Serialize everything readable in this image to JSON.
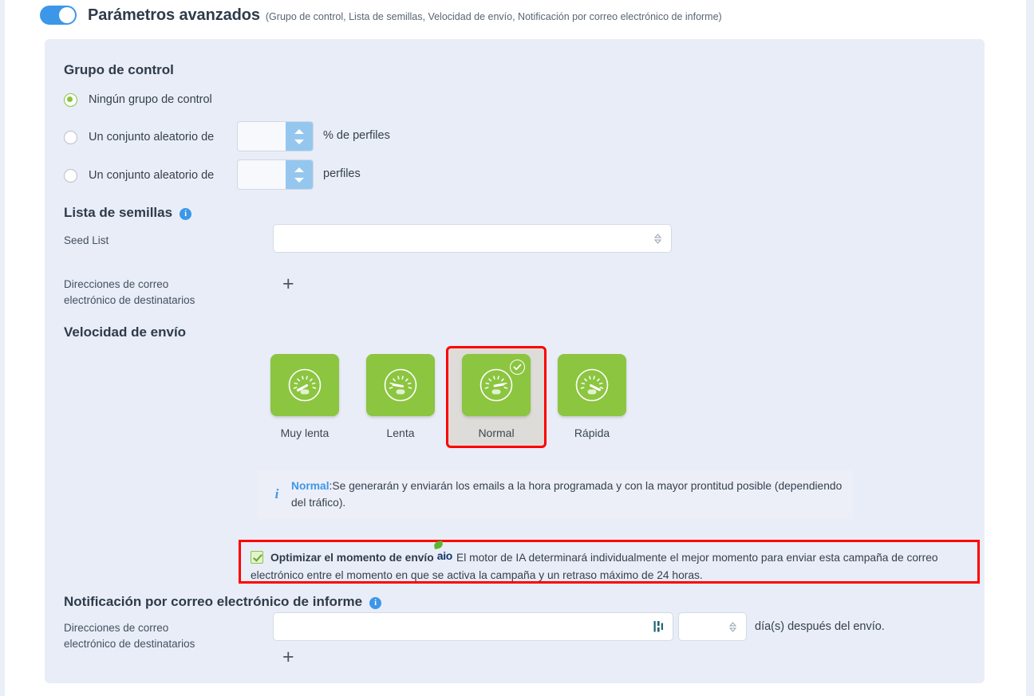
{
  "header": {
    "toggle_state": "on",
    "title": "Parámetros avanzados",
    "subtitle": "(Grupo de control, Lista de semillas, Velocidad de envío, Notificación por correo electrónico de informe)"
  },
  "control_group": {
    "title": "Grupo de control",
    "options": [
      {
        "label": "Ningún grupo de control",
        "selected": true
      },
      {
        "label": "Un conjunto aleatorio de",
        "selected": false,
        "value": "",
        "unit": "% de perfiles"
      },
      {
        "label": "Un conjunto aleatorio de",
        "selected": false,
        "value": "",
        "unit": "perfiles"
      }
    ]
  },
  "seed_list": {
    "title": "Lista de semillas",
    "info_icon": "info-icon",
    "seed_label": "Seed List",
    "seed_value": "",
    "recipients_label": "Direcciones de correo electrónico de destinatarios",
    "add_label": "+"
  },
  "speed": {
    "title": "Velocidad de envío",
    "tiles": [
      {
        "label": "Muy lenta",
        "icon": "gauge-icon",
        "selected": false
      },
      {
        "label": "Lenta",
        "icon": "gauge-icon",
        "selected": false
      },
      {
        "label": "Normal",
        "icon": "gauge-icon",
        "selected": true
      },
      {
        "label": "Rápida",
        "icon": "gauge-icon",
        "selected": false
      }
    ],
    "note_icon": "info-italic-icon",
    "note_strong": "Normal",
    "note_text": ":Se generarán y enviarán los emails a la hora programada y con la mayor prontitud posible (dependiendo del tráfico)."
  },
  "optimize": {
    "checked": true,
    "label": "Optimizar el momento de envío",
    "badge": "aio",
    "description": "El motor de IA determinará individualmente el mejor momento para enviar esta campaña de correo electrónico entre el momento en que se activa la campaña y un retraso máximo de 24 horas."
  },
  "report_notification": {
    "title": "Notificación por correo electrónico de informe",
    "info_icon": "info-icon",
    "recipients_label": "Direcciones de correo electrónico de destinatarios",
    "recipients_value": "",
    "personalization_icon": "personalization-icon",
    "days_value": "",
    "days_label": "día(s) después del envío.",
    "add_label": "+"
  },
  "colors": {
    "accent_blue": "#3d97e8",
    "green": "#8cc540",
    "highlight_red": "#ff0000",
    "card_bg": "#e9edf7",
    "text": "#36404e"
  }
}
